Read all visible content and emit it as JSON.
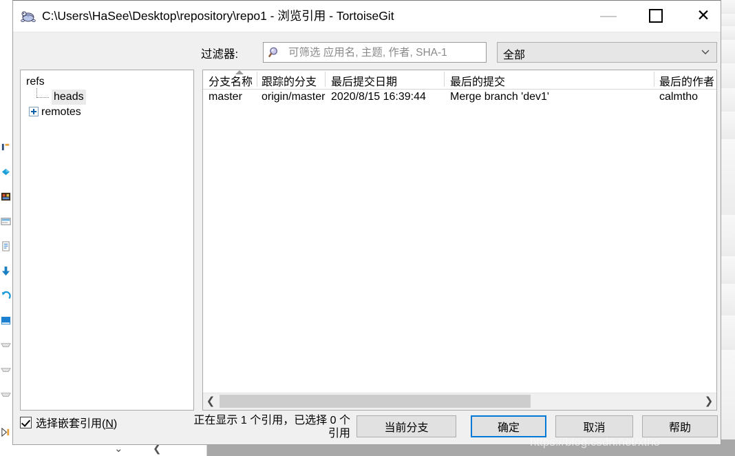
{
  "window": {
    "title": "C:\\Users\\HaSee\\Desktop\\repository\\repo1 - 浏览引用 - TortoiseGit",
    "icon": "tortoisegit-turtle-icon",
    "minimize_label": "",
    "maximize_label": "",
    "close_label": "✕"
  },
  "filter": {
    "label": "过滤器:",
    "search_placeholder": "可筛选 应用名, 主题, 作者, SHA-1",
    "search_value": "",
    "search_icon": "magnifier-icon",
    "select_value": "全部",
    "select_options": [
      "全部"
    ],
    "select_icon": "chevron-down-icon"
  },
  "tree": {
    "nodes": [
      {
        "label": "refs",
        "level": 0,
        "expanded": true,
        "selected": false
      },
      {
        "label": "heads",
        "level": 1,
        "expanded": false,
        "selected": true
      },
      {
        "label": "remotes",
        "level": 1,
        "expanded": false,
        "selected": false
      }
    ],
    "expander_icon": "plus-box-icon"
  },
  "list": {
    "columns": [
      {
        "label": "分支名称",
        "sorted": "asc"
      },
      {
        "label": "跟踪的分支",
        "sorted": ""
      },
      {
        "label": "最后提交日期",
        "sorted": ""
      },
      {
        "label": "最后的提交",
        "sorted": ""
      },
      {
        "label": "最后的作者",
        "sorted": ""
      }
    ],
    "rows": [
      {
        "branch": "master",
        "tracked": "origin/master",
        "date": "2020/8/15 16:39:44",
        "commit": "Merge branch 'dev1'",
        "author": "calmtho"
      }
    ],
    "scrollbar": {
      "left_arrow": "❮",
      "right_arrow": "❯"
    }
  },
  "footer": {
    "checkbox_label_main": "选择嵌套引用(",
    "checkbox_mnemonic": "N",
    "checkbox_label_end": ")",
    "checkbox_checked": true,
    "status_line1": "正在显示 1 个引用，已选择 0 个",
    "status_line2": "引用",
    "buttons": {
      "current_branch": "当前分支",
      "ok": "确定",
      "cancel": "取消",
      "help": "帮助"
    }
  },
  "watermark": {
    "text": "https://blog.csdn.net/xtho"
  },
  "colors": {
    "accent": "#0078d7",
    "dialog_bg": "#f0f0f0",
    "panel_bg": "#ffffff",
    "button_bg": "#e1e1e1"
  }
}
